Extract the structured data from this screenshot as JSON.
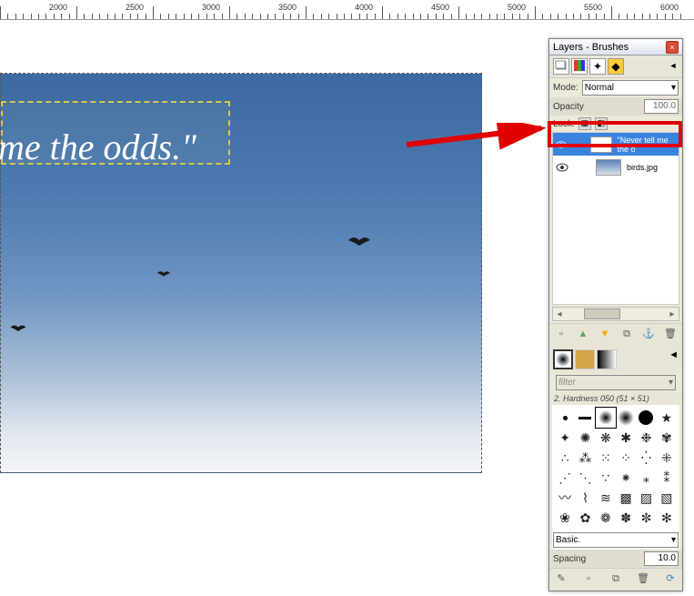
{
  "ruler": {
    "labels": [
      "2000",
      "2500",
      "3000",
      "3500",
      "4000",
      "4500",
      "5000",
      "5500",
      "6000"
    ]
  },
  "canvas": {
    "text": "me the odds.\""
  },
  "panel": {
    "title": "Layers - Brushes",
    "mode_label": "Mode:",
    "mode_value": "Normal",
    "opacity_label": "Opacity",
    "opacity_value": "100.0",
    "lock_label": "Lock:",
    "layers": [
      {
        "name": "\"Never tell me the o",
        "selected": true
      },
      {
        "name": "birds.jpg",
        "selected": false
      }
    ],
    "filter_placeholder": "filter",
    "brush_info": "2. Hardness 050 (51 × 51)",
    "basic_label": "Basic.",
    "spacing_label": "Spacing",
    "spacing_value": "10.0"
  }
}
